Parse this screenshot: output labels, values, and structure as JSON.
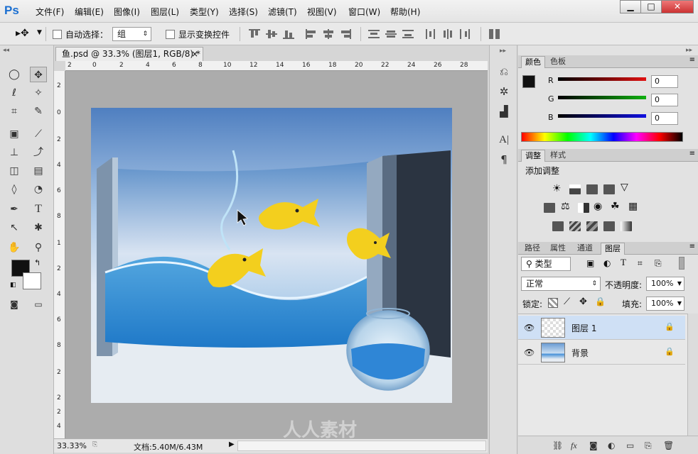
{
  "app": {
    "logo": "Ps"
  },
  "menu": [
    "文件(F)",
    "编辑(E)",
    "图像(I)",
    "图层(L)",
    "类型(Y)",
    "选择(S)",
    "滤镜(T)",
    "视图(V)",
    "窗口(W)",
    "帮助(H)"
  ],
  "window_controls": {
    "minimize": "▁",
    "maximize": "□",
    "close": "✕"
  },
  "options_bar": {
    "auto_select_label": "自动选择：",
    "auto_select_target": "组",
    "show_transform_label": "显示变换控件"
  },
  "document": {
    "tab_title": "鱼.psd @ 33.3% (图层1, RGB/8) *",
    "close": "×",
    "zoom": "33.33%",
    "doc_size": "文档:5.40M/6.43M",
    "ruler_top": [
      "2",
      "0",
      "2",
      "4",
      "6",
      "8",
      "10",
      "12",
      "14",
      "16",
      "18",
      "20",
      "22",
      "24",
      "26",
      "28"
    ],
    "ruler_left": [
      "2",
      "0",
      "2",
      "4",
      "6",
      "8",
      "1",
      "2",
      "4",
      "6",
      "8",
      "2",
      "2",
      "2",
      "4"
    ]
  },
  "color_panel": {
    "tabs": [
      "颜色",
      "色板"
    ],
    "channels": [
      {
        "label": "R",
        "value": "0",
        "color": "#e01010"
      },
      {
        "label": "G",
        "value": "0",
        "color": "#10b010"
      },
      {
        "label": "B",
        "value": "0",
        "color": "#1010e0"
      }
    ]
  },
  "adjust_panel": {
    "tabs": [
      "调整",
      "样式"
    ],
    "heading": "添加调整"
  },
  "layers_panel": {
    "tabs": [
      "路径",
      "属性",
      "通道",
      "图层"
    ],
    "filter_kind": "类型",
    "blend_mode": "正常",
    "opacity_label": "不透明度:",
    "opacity_value": "100%",
    "lock_label": "锁定:",
    "fill_label": "填充:",
    "fill_value": "100%",
    "layers": [
      {
        "name": "图层 1",
        "selected": true
      },
      {
        "name": "背景",
        "selected": false
      }
    ]
  },
  "watermark": "人人素材",
  "colors": {
    "accent": "#1b6fd1",
    "selected_layer": "#cfe0f5"
  }
}
